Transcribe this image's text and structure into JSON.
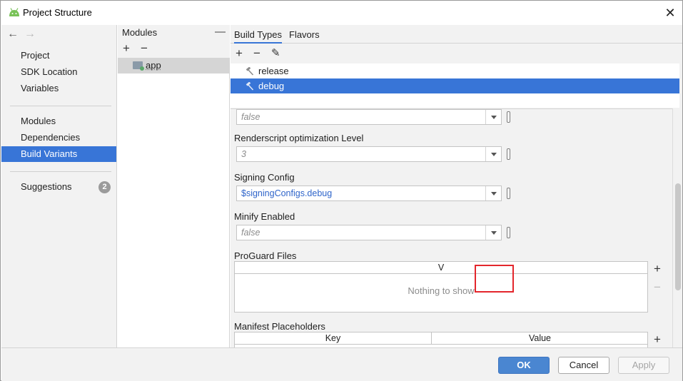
{
  "window": {
    "title": "Project Structure"
  },
  "nav": {
    "back": "←",
    "forward": "→",
    "group1": [
      "Project",
      "SDK Location",
      "Variables"
    ],
    "group2": [
      "Modules",
      "Dependencies",
      "Build Variants"
    ],
    "selected": "Build Variants",
    "suggestions": {
      "label": "Suggestions",
      "count": "2"
    }
  },
  "modules": {
    "title": "Modules",
    "collapse": "—",
    "add": "+",
    "remove": "−",
    "items": [
      "app"
    ]
  },
  "build_variants": {
    "tabs": [
      "Build Types",
      "Flavors"
    ],
    "active_tab": "Build Types",
    "tools": {
      "add": "+",
      "remove": "−",
      "edit": "✎"
    },
    "build_types": [
      "release",
      "debug"
    ],
    "selected_build_type": "debug"
  },
  "form": {
    "partial_field": {
      "value": "false"
    },
    "renderscript": {
      "label": "Renderscript optimization Level",
      "value": "3"
    },
    "signing_config": {
      "label": "Signing Config",
      "value": "$signingConfigs.debug"
    },
    "minify": {
      "label": "Minify Enabled",
      "value": "false"
    },
    "proguard": {
      "label": "ProGuard Files",
      "column": "V",
      "empty_text": "Nothing to show",
      "add": "+",
      "remove": "−"
    },
    "manifest_placeholders": {
      "label": "Manifest Placeholders",
      "columns": [
        "Key",
        "Value"
      ],
      "add": "+"
    }
  },
  "buttons": {
    "ok": "OK",
    "cancel": "Cancel",
    "apply": "Apply"
  },
  "colors": {
    "accent": "#3875d7",
    "highlight": "#e3262c",
    "android": "#78c257"
  }
}
